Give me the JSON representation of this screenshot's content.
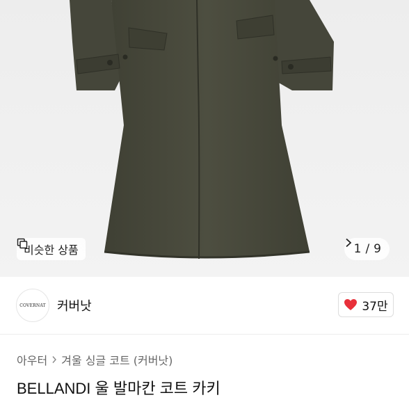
{
  "gallery": {
    "similar_label": "비슷한 상품",
    "current_page": "1",
    "page_separator": "/",
    "total_pages": "9"
  },
  "seller": {
    "logo_text": "COVERNAT",
    "name": "커버낫",
    "like_count": "37만"
  },
  "breadcrumb": {
    "items": [
      "아우터",
      "겨울 싱글 코트 (커버낫)"
    ]
  },
  "product": {
    "title": "BELLANDI 울 발마칸 코트 카키"
  },
  "colors": {
    "coat": "#4a4a3c",
    "heart": "#e8303a"
  }
}
